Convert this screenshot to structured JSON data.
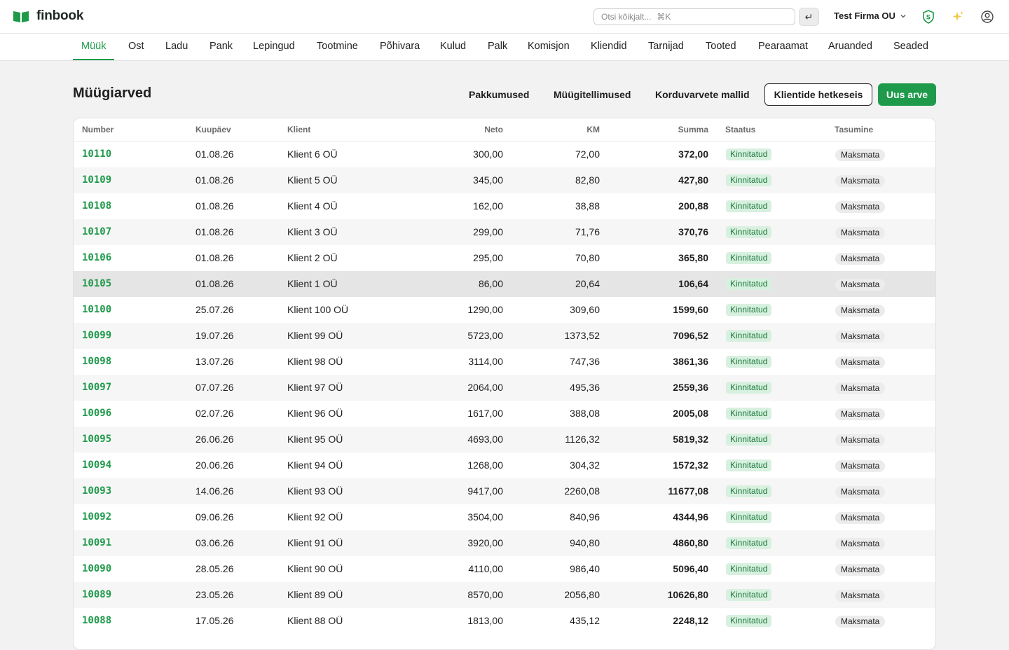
{
  "app": {
    "name": "finbook"
  },
  "header": {
    "search_placeholder": "Otsi kõikjalt...",
    "search_shortcut": "⌘K",
    "enter_symbol": "↵",
    "company": "Test Firma OU"
  },
  "nav": [
    {
      "label": "Müük",
      "active": true
    },
    {
      "label": "Ost"
    },
    {
      "label": "Ladu"
    },
    {
      "label": "Pank"
    },
    {
      "label": "Lepingud"
    },
    {
      "label": "Tootmine"
    },
    {
      "label": "Põhivara"
    },
    {
      "label": "Kulud"
    },
    {
      "label": "Palk"
    },
    {
      "label": "Komisjon"
    },
    {
      "label": "Kliendid"
    },
    {
      "label": "Tarnijad"
    },
    {
      "label": "Tooted"
    },
    {
      "label": "Pearaamat"
    },
    {
      "label": "Aruanded"
    },
    {
      "label": "Seaded"
    }
  ],
  "page": {
    "title": "Müügiarved",
    "links": [
      "Pakkumused",
      "Müügitellimused",
      "Korduvarvete mallid"
    ],
    "outline_button": "Klientide hetkeseis",
    "primary_button": "Uus arve"
  },
  "table": {
    "columns": [
      "Number",
      "Kuupäev",
      "Klient",
      "Neto",
      "KM",
      "Summa",
      "Staatus",
      "Tasumine"
    ],
    "rows": [
      {
        "number": "10110",
        "date": "01.08.26",
        "client": "Klient 6 OÜ",
        "neto": "300,00",
        "km": "72,00",
        "sum": "372,00",
        "status": "Kinnitatud",
        "payment": "Maksmata"
      },
      {
        "number": "10109",
        "date": "01.08.26",
        "client": "Klient 5 OÜ",
        "neto": "345,00",
        "km": "82,80",
        "sum": "427,80",
        "status": "Kinnitatud",
        "payment": "Maksmata"
      },
      {
        "number": "10108",
        "date": "01.08.26",
        "client": "Klient 4 OÜ",
        "neto": "162,00",
        "km": "38,88",
        "sum": "200,88",
        "status": "Kinnitatud",
        "payment": "Maksmata"
      },
      {
        "number": "10107",
        "date": "01.08.26",
        "client": "Klient 3 OÜ",
        "neto": "299,00",
        "km": "71,76",
        "sum": "370,76",
        "status": "Kinnitatud",
        "payment": "Maksmata"
      },
      {
        "number": "10106",
        "date": "01.08.26",
        "client": "Klient 2 OÜ",
        "neto": "295,00",
        "km": "70,80",
        "sum": "365,80",
        "status": "Kinnitatud",
        "payment": "Maksmata"
      },
      {
        "number": "10105",
        "date": "01.08.26",
        "client": "Klient 1 OÜ",
        "neto": "86,00",
        "km": "20,64",
        "sum": "106,64",
        "status": "Kinnitatud",
        "payment": "Maksmata",
        "highlight": true
      },
      {
        "number": "10100",
        "date": "25.07.26",
        "client": "Klient 100 OÜ",
        "neto": "1290,00",
        "km": "309,60",
        "sum": "1599,60",
        "status": "Kinnitatud",
        "payment": "Maksmata"
      },
      {
        "number": "10099",
        "date": "19.07.26",
        "client": "Klient 99 OÜ",
        "neto": "5723,00",
        "km": "1373,52",
        "sum": "7096,52",
        "status": "Kinnitatud",
        "payment": "Maksmata"
      },
      {
        "number": "10098",
        "date": "13.07.26",
        "client": "Klient 98 OÜ",
        "neto": "3114,00",
        "km": "747,36",
        "sum": "3861,36",
        "status": "Kinnitatud",
        "payment": "Maksmata"
      },
      {
        "number": "10097",
        "date": "07.07.26",
        "client": "Klient 97 OÜ",
        "neto": "2064,00",
        "km": "495,36",
        "sum": "2559,36",
        "status": "Kinnitatud",
        "payment": "Maksmata"
      },
      {
        "number": "10096",
        "date": "02.07.26",
        "client": "Klient 96 OÜ",
        "neto": "1617,00",
        "km": "388,08",
        "sum": "2005,08",
        "status": "Kinnitatud",
        "payment": "Maksmata"
      },
      {
        "number": "10095",
        "date": "26.06.26",
        "client": "Klient 95 OÜ",
        "neto": "4693,00",
        "km": "1126,32",
        "sum": "5819,32",
        "status": "Kinnitatud",
        "payment": "Maksmata"
      },
      {
        "number": "10094",
        "date": "20.06.26",
        "client": "Klient 94 OÜ",
        "neto": "1268,00",
        "km": "304,32",
        "sum": "1572,32",
        "status": "Kinnitatud",
        "payment": "Maksmata"
      },
      {
        "number": "10093",
        "date": "14.06.26",
        "client": "Klient 93 OÜ",
        "neto": "9417,00",
        "km": "2260,08",
        "sum": "11677,08",
        "status": "Kinnitatud",
        "payment": "Maksmata"
      },
      {
        "number": "10092",
        "date": "09.06.26",
        "client": "Klient 92 OÜ",
        "neto": "3504,00",
        "km": "840,96",
        "sum": "4344,96",
        "status": "Kinnitatud",
        "payment": "Maksmata"
      },
      {
        "number": "10091",
        "date": "03.06.26",
        "client": "Klient 91 OÜ",
        "neto": "3920,00",
        "km": "940,80",
        "sum": "4860,80",
        "status": "Kinnitatud",
        "payment": "Maksmata"
      },
      {
        "number": "10090",
        "date": "28.05.26",
        "client": "Klient 90 OÜ",
        "neto": "4110,00",
        "km": "986,40",
        "sum": "5096,40",
        "status": "Kinnitatud",
        "payment": "Maksmata"
      },
      {
        "number": "10089",
        "date": "23.05.26",
        "client": "Klient 89 OÜ",
        "neto": "8570,00",
        "km": "2056,80",
        "sum": "10626,80",
        "status": "Kinnitatud",
        "payment": "Maksmata"
      },
      {
        "number": "10088",
        "date": "17.05.26",
        "client": "Klient 88 OÜ",
        "neto": "1813,00",
        "km": "435,12",
        "sum": "2248,12",
        "status": "Kinnitatud",
        "payment": "Maksmata"
      }
    ]
  },
  "colors": {
    "accent": "#1f9a4b",
    "badge_bg": "#d8f0df",
    "badge_text": "#1c7a3d"
  },
  "icons": {
    "logo": "book-icon",
    "shield": "shield-icon",
    "sparkle": "sparkle-icon",
    "account": "account-icon"
  }
}
